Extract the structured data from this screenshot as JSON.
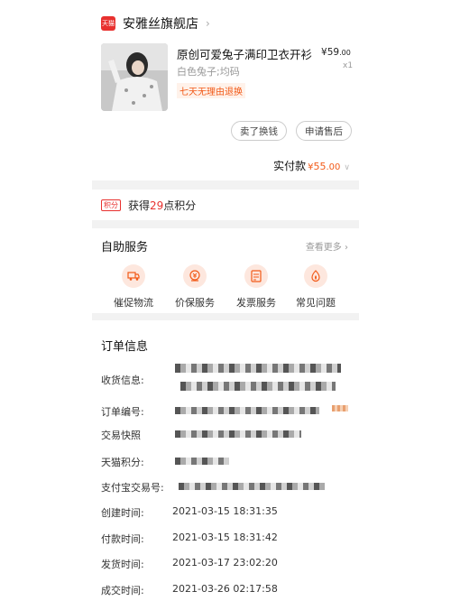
{
  "shop": {
    "badge_text": "天猫",
    "name": "安雅丝旗舰店",
    "product_title": "原创可爱兔子满印卫衣开衫…",
    "price_symbol": "¥",
    "price_main": "59",
    "price_decimal": ".00",
    "quantity": "x1",
    "sku": "白色兔子;均码",
    "return_tag": "七天无理由退换",
    "btn_sell_swap": "卖了换钱",
    "btn_after_sale": "申请售后",
    "paid_label": "实付款",
    "paid_symbol": "¥",
    "paid_main": "55",
    "paid_decimal": ".00"
  },
  "points": {
    "icon_text": "积分",
    "prefix": "获得",
    "number": "29",
    "suffix": "点积分"
  },
  "services": {
    "title": "自助服务",
    "more": "查看更多",
    "items": [
      {
        "label": "催促物流",
        "icon": "truck-icon"
      },
      {
        "label": "价保服务",
        "icon": "price-protect-icon"
      },
      {
        "label": "发票服务",
        "icon": "invoice-icon"
      },
      {
        "label": "常见问题",
        "icon": "faq-icon"
      }
    ]
  },
  "order": {
    "title": "订单信息",
    "rows": {
      "shipping": {
        "label": "收货信息:"
      },
      "order_no": {
        "label": "订单编号:"
      },
      "snapshot": {
        "label": "交易快照"
      },
      "tmall_points": {
        "label": "天猫积分:"
      },
      "alipay_no": {
        "label": "支付宝交易号:"
      },
      "created": {
        "label": "创建时间:",
        "value": "2021-03-15 18:31:35"
      },
      "paid": {
        "label": "付款时间:",
        "value": "2021-03-15 18:31:42"
      },
      "shipped": {
        "label": "发货时间:",
        "value": "2021-03-17 23:02:20"
      },
      "done": {
        "label": "成交时间:",
        "value": "2021-03-26 02:17:58"
      }
    }
  },
  "colors": {
    "accent": "#f25a18",
    "tmall_red": "#e8312f",
    "service_bg": "#fde7de"
  }
}
